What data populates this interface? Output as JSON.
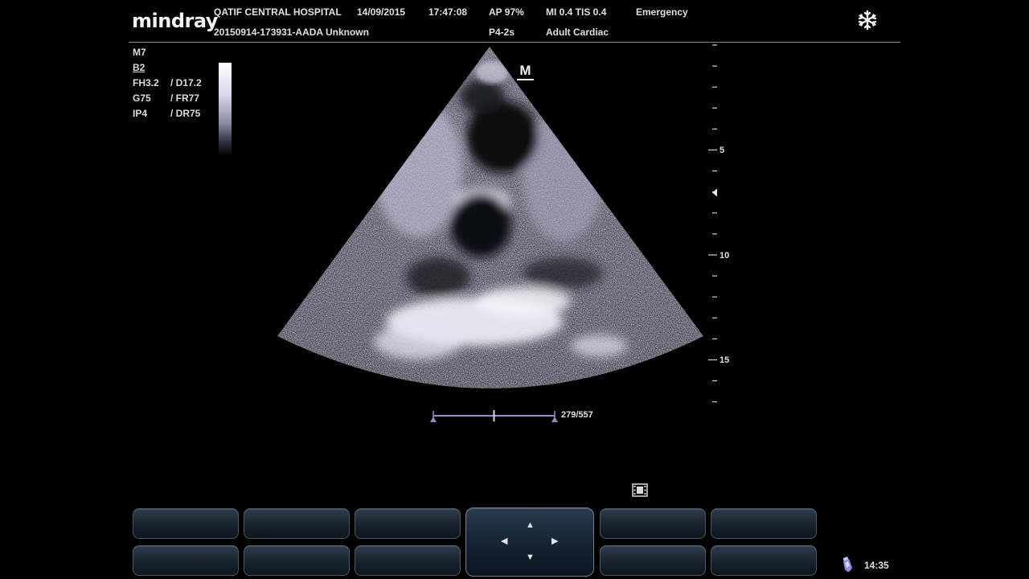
{
  "header": {
    "brand": "mindray",
    "hospital": "QATIF CENTRAL HOSPITAL",
    "date": "14/09/2015",
    "time": "17:47:08",
    "acoustic_power": "AP  97%",
    "mechanical_index": "MI 0.4  TIS 0.4",
    "preset_mode": "Emergency",
    "patient_id": "20150914-173931-AADA Unknown",
    "probe": "P4-2s",
    "exam_type": "Adult Cardiac"
  },
  "imaging_params": {
    "zoom_mode": "M7",
    "mode": "B2",
    "frequency": "FH3.2",
    "depth": "/ D17.2",
    "gain": "G75",
    "frame_rate": "/ FR77",
    "image_process": "IP4",
    "dynamic_range": "/ DR75"
  },
  "image": {
    "orientation_marker": "M"
  },
  "depth_scale": {
    "labels": [
      "5",
      "10",
      "15"
    ]
  },
  "cine": {
    "frame_counter": "279/557",
    "position": 0.5
  },
  "softkeys": {
    "top_row": [
      "",
      "",
      "",
      "",
      "",
      ""
    ],
    "bottom_row": [
      "",
      "",
      "",
      "",
      "",
      ""
    ]
  },
  "footer": {
    "clock": "14:35"
  },
  "icons": [
    "freeze-snowflake-icon",
    "film-strip-icon",
    "probe-icon",
    "arrow-up-icon",
    "arrow-down-icon",
    "arrow-left-icon",
    "arrow-right-icon"
  ],
  "colors": {
    "background": "#000000",
    "cine_bar": "#8f8fc8",
    "image_tint": "#d8d4ee"
  }
}
